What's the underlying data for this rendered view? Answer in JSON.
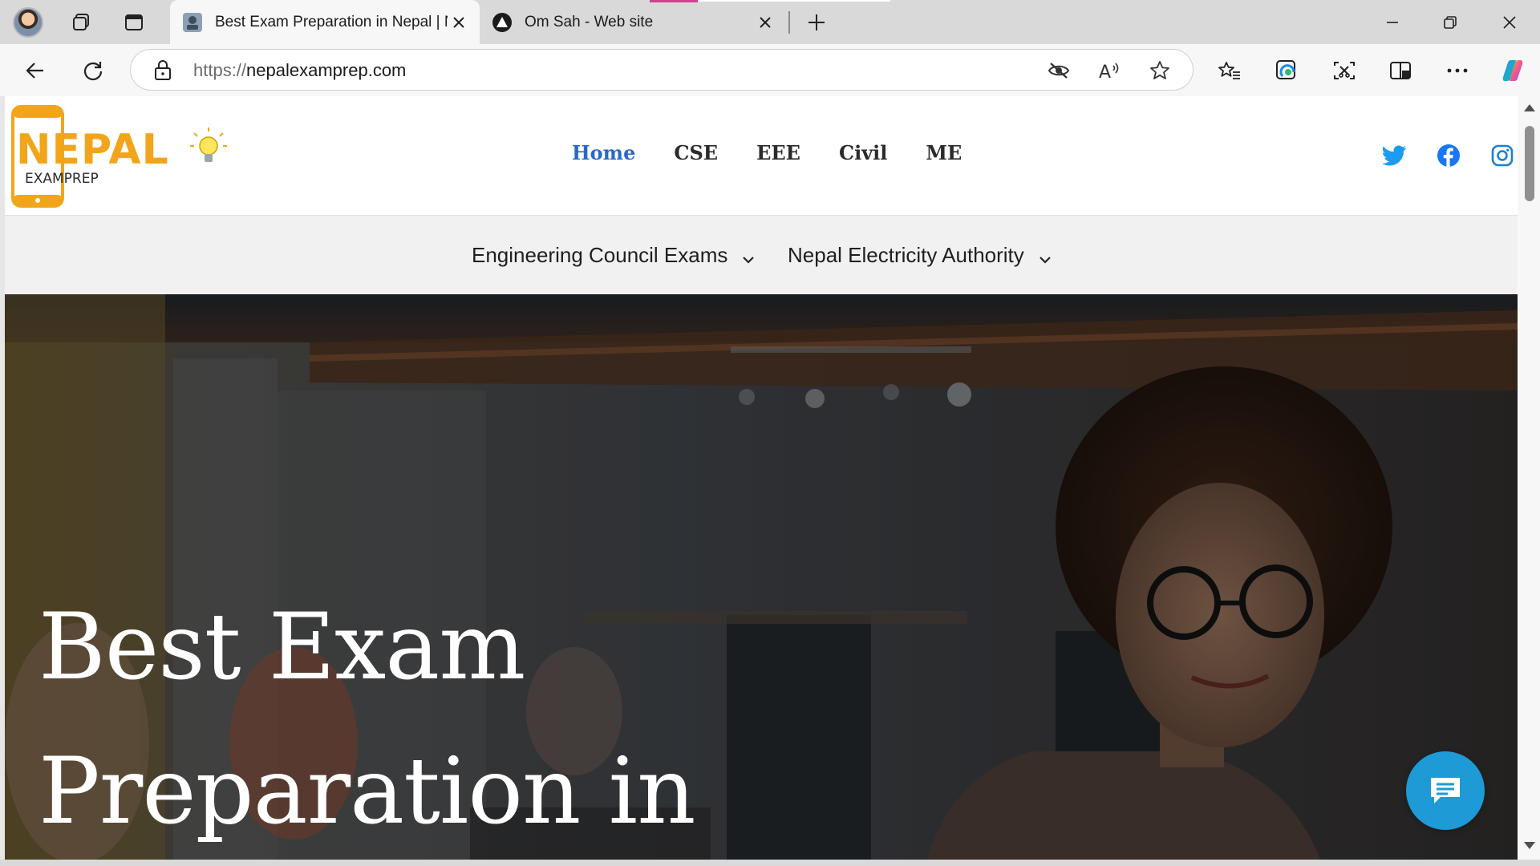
{
  "browser": {
    "tabs": [
      {
        "title": "Best Exam Preparation in Nepal | Nepal Exam Prep",
        "active": true
      },
      {
        "title": "Om Sah - Web site",
        "active": false
      }
    ],
    "address": {
      "protocol": "https://",
      "host": "nepalexamprep.com"
    },
    "icons": {
      "tab_bar": [
        "profile-avatar",
        "workspaces-icon",
        "tab-actions-icon",
        "new-tab-icon",
        "minimize-icon",
        "restore-icon",
        "close-window-icon"
      ],
      "toolbar": [
        "back-icon",
        "refresh-icon",
        "site-info-lock-icon",
        "tracking-prevention-icon",
        "read-aloud-icon",
        "favorite-star-icon",
        "favorites-list-icon",
        "browser-essentials-icon",
        "screenshot-icon",
        "split-screen-icon",
        "more-options-icon",
        "copilot-icon"
      ]
    }
  },
  "site": {
    "logo": {
      "word": "NEPAL",
      "tagline": "EXAMPREP"
    },
    "nav": [
      {
        "label": "Home",
        "current": true
      },
      {
        "label": "CSE",
        "current": false
      },
      {
        "label": "EEE",
        "current": false
      },
      {
        "label": "Civil",
        "current": false
      },
      {
        "label": "ME",
        "current": false
      }
    ],
    "social": [
      "twitter-icon",
      "facebook-icon",
      "instagram-icon"
    ],
    "subnav": [
      {
        "label": "Engineering Council Exams"
      },
      {
        "label": "Nepal Electricity Authority"
      }
    ],
    "hero": {
      "title_line1": "Best Exam",
      "title_line2": "Preparation in"
    },
    "chat": {
      "icon": "chat-icon"
    }
  },
  "colors": {
    "nav_active": "#2a68c7",
    "logo_orange": "#f2a51a",
    "twitter": "#1d9bf0",
    "facebook": "#1877f2",
    "instagram": "#1d7fd1",
    "chat": "#1e9ad6"
  }
}
